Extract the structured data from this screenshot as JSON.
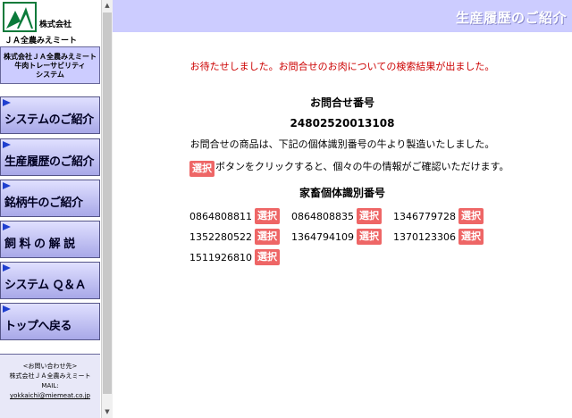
{
  "sidebar": {
    "logo": {
      "text1": "株式会社",
      "text2": "ＪＡ全農みえミート"
    },
    "system_box": [
      "株式会社ＪＡ全農みえミート",
      "牛肉トレーサビリティ",
      "システム"
    ],
    "menu": [
      {
        "label": "システムのご紹介"
      },
      {
        "label": "生産履歴のご紹介"
      },
      {
        "label": "銘柄牛のご紹介"
      },
      {
        "label": "飼 料 の 解 説"
      },
      {
        "label": "システム Ｑ＆Ａ"
      },
      {
        "label": "トップへ戻る"
      }
    ],
    "contact": {
      "heading": "<お問い合わせ先>",
      "company": "株式会社ＪＡ全農みえミート",
      "mail_label": "MAIL:",
      "email": "yokkaichi@miemeat.co.jp"
    }
  },
  "header": {
    "title": "生産履歴のご紹介"
  },
  "main": {
    "notice": "お待たせしました。お問合せのお肉についての検索結果が出ました。",
    "inquiry_heading": "お問合せ番号",
    "inquiry_number": "24802520013108",
    "message1": "お問合せの商品は、下記の個体識別番号の牛より製造いたしました。",
    "message2_button": "選択",
    "message2_text": "ボタンをクリックすると、個々の牛の情報がご確認いただけます。",
    "cattle_heading": "家畜個体識別番号",
    "select_label": "選択",
    "cattle_ids": [
      "0864808811",
      "0864808835",
      "1346779728",
      "1352280522",
      "1364794109",
      "1370123306",
      "1511926810"
    ]
  },
  "colors": {
    "header_bg": "#ccccff",
    "notice_text": "#cc0000",
    "select_button": "#ee6666",
    "menu_arrow": "#1f3fcf"
  }
}
